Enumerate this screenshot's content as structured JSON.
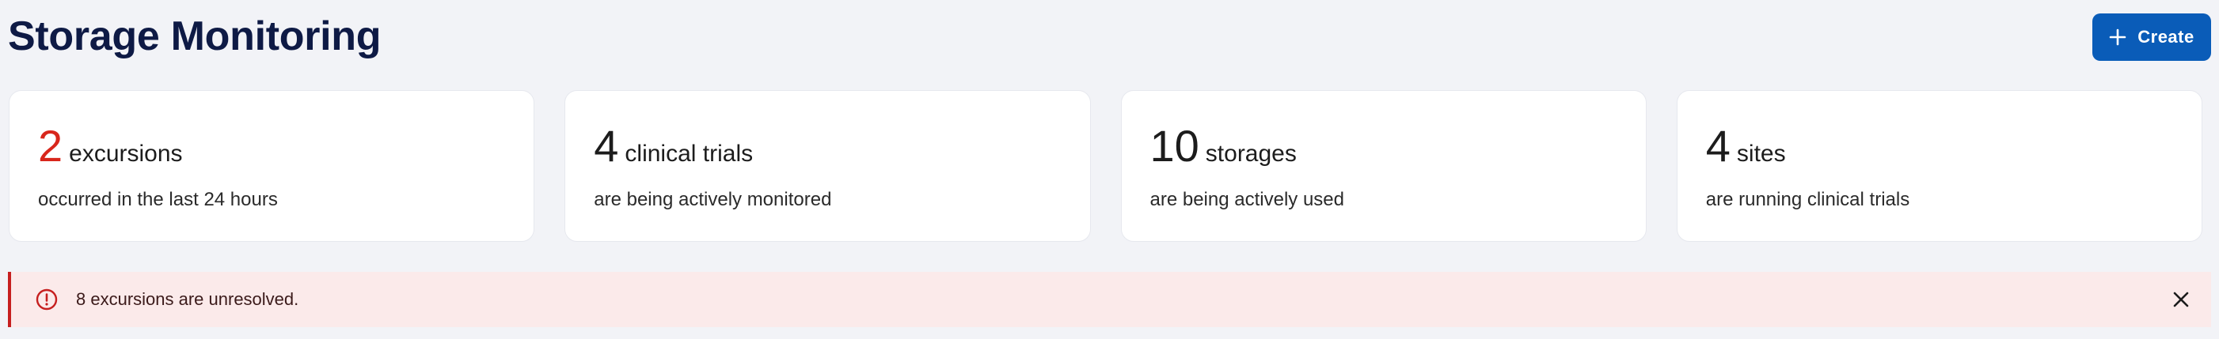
{
  "header": {
    "title": "Storage Monitoring",
    "create_label": "Create"
  },
  "cards": [
    {
      "value": "2",
      "unit": "excursions",
      "description": "occurred in the last 24 hours",
      "value_color": "#d8261b"
    },
    {
      "value": "4",
      "unit": "clinical trials",
      "description": "are being actively monitored"
    },
    {
      "value": "10",
      "unit": "storages",
      "description": "are being actively used"
    },
    {
      "value": "4",
      "unit": "sites",
      "description": "are running clinical trials"
    }
  ],
  "alert": {
    "message": "8 excursions are unresolved.",
    "icon": "error-circle-icon",
    "close_icon": "close-icon"
  },
  "colors": {
    "accent": "#0a5cb8",
    "title": "#0e1a45",
    "alert": "#c61f1f",
    "alert_bg": "#fbeaea"
  }
}
